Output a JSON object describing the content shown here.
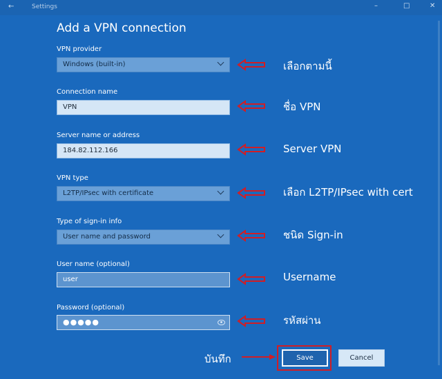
{
  "window": {
    "title": "Settings"
  },
  "dialog": {
    "title": "Add a VPN connection"
  },
  "fields": {
    "vpn_provider": {
      "label": "VPN provider",
      "value": "Windows (built-in)"
    },
    "connection_name": {
      "label": "Connection name",
      "value": "VPN"
    },
    "server": {
      "label": "Server name or address",
      "value": "184.82.112.166"
    },
    "vpn_type": {
      "label": "VPN type",
      "value": "L2TP/IPsec with certificate"
    },
    "signin_type": {
      "label": "Type of sign-in info",
      "value": "User name and password"
    },
    "username": {
      "label": "User name (optional)",
      "value": "user"
    },
    "password": {
      "label": "Password (optional)",
      "value": "●●●●●"
    }
  },
  "annotations": {
    "vpn_provider": "เลือกตามนี้",
    "connection_name": "ชื่อ VPN",
    "server": "Server VPN",
    "vpn_type": "เลือก L2TP/IPsec with cert",
    "signin_type": "ชนิด Sign-in",
    "username": "Username",
    "password": "รหัสผ่าน",
    "save": "บันทึก"
  },
  "buttons": {
    "save": "Save",
    "cancel": "Cancel"
  },
  "colors": {
    "background": "#1a69bd",
    "annotation_red": "#d21d24",
    "field_light": "#d5e6f6",
    "field_select": "#6aa0d7"
  }
}
